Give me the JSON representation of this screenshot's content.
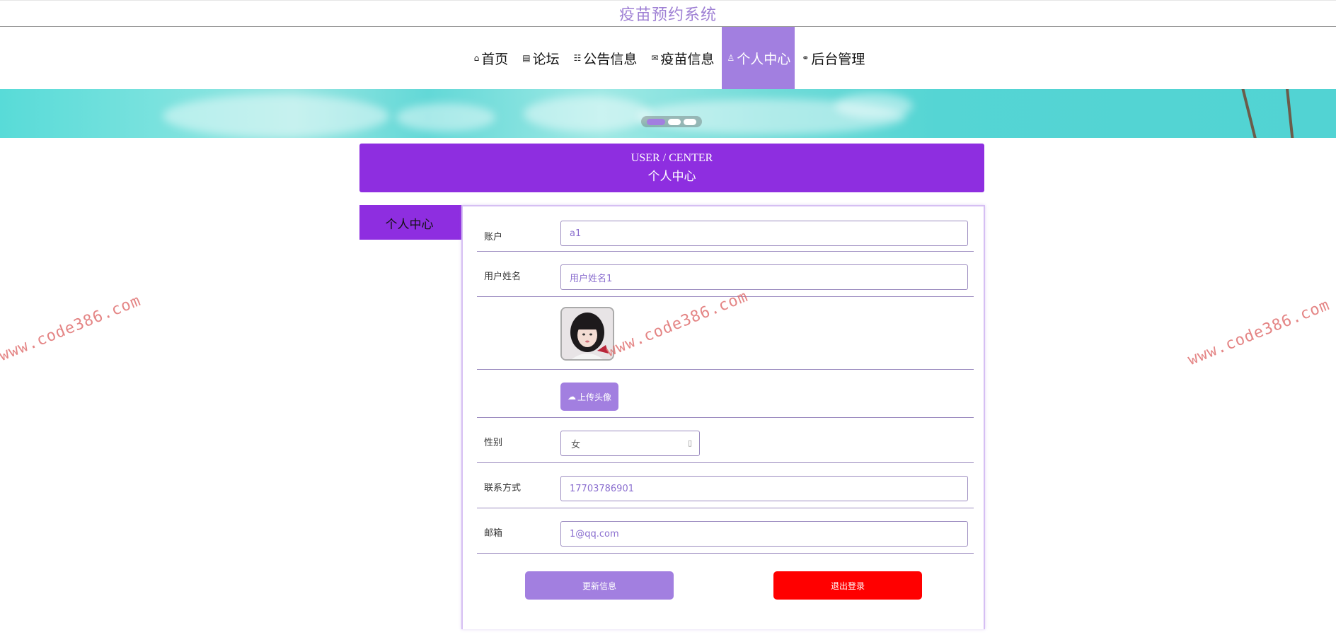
{
  "app": {
    "title": "疫苗预约系统"
  },
  "nav": {
    "items": [
      {
        "label": "首页",
        "icon": "home-icon"
      },
      {
        "label": "论坛",
        "icon": "forum-icon"
      },
      {
        "label": "公告信息",
        "icon": "notice-icon"
      },
      {
        "label": "疫苗信息",
        "icon": "mail-icon"
      },
      {
        "label": "个人中心",
        "icon": "user-icon",
        "active": true
      },
      {
        "label": "后台管理",
        "icon": "link-icon"
      }
    ]
  },
  "section": {
    "title_en": "USER / CENTER",
    "title_cn": "个人中心"
  },
  "sidebar": {
    "tab_label": "个人中心"
  },
  "form": {
    "account": {
      "label": "账户",
      "value": "a1"
    },
    "username": {
      "label": "用户姓名",
      "value": "用户姓名1"
    },
    "upload_label": "上传头像",
    "gender": {
      "label": "性别",
      "value": "女"
    },
    "phone": {
      "label": "联系方式",
      "value": "17703786901"
    },
    "email": {
      "label": "邮箱",
      "value": "1@qq.com"
    },
    "update_label": "更新信息",
    "logout_label": "退出登录"
  },
  "watermark": "www.code386.com",
  "colors": {
    "accent": "#a27fe0",
    "header_purple": "#8e2ee0",
    "danger": "#ff0000",
    "title": "#9e7fd4"
  },
  "carousel": {
    "slides": 3,
    "active": 1
  }
}
